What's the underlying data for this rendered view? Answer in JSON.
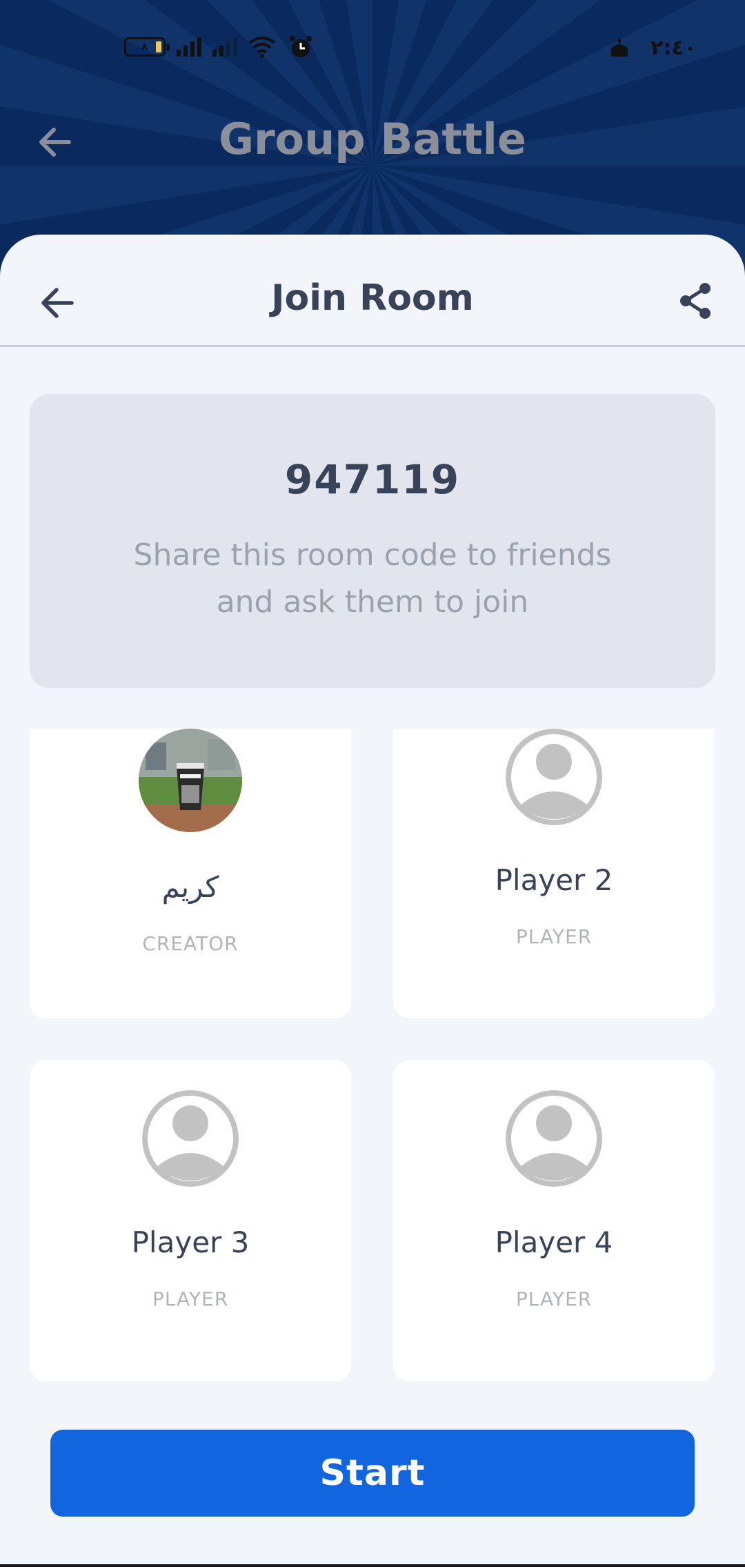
{
  "status_bar": {
    "battery_level": "٨",
    "time": "٢:٤٠",
    "icons": [
      "battery-icon",
      "signal-icon",
      "signal-icon",
      "wifi-icon",
      "alarm-icon",
      "mosque-icon"
    ]
  },
  "banner": {
    "title": "Group Battle",
    "back_icon": "arrow-left-icon"
  },
  "sheet": {
    "title": "Join Room",
    "back_icon": "arrow-left-icon",
    "share_icon": "share-icon"
  },
  "room": {
    "code": "947119",
    "hint": "Share this room code to friends and ask them to join"
  },
  "players": [
    {
      "name": "كريم",
      "role": "CREATOR",
      "avatar": "photo"
    },
    {
      "name": "Player 2",
      "role": "PLAYER",
      "avatar": "placeholder"
    },
    {
      "name": "Player 3",
      "role": "PLAYER",
      "avatar": "placeholder"
    },
    {
      "name": "Player 4",
      "role": "PLAYER",
      "avatar": "placeholder"
    }
  ],
  "actions": {
    "start_label": "Start"
  },
  "colors": {
    "banner": "#0b2f66",
    "sheet_bg": "#f2f5f9",
    "card_bg": "#ffffff",
    "code_card_bg": "#e2e6ec",
    "primary": "#1166e0",
    "text_dark": "#374358",
    "text_muted": "#9aa2ad"
  }
}
